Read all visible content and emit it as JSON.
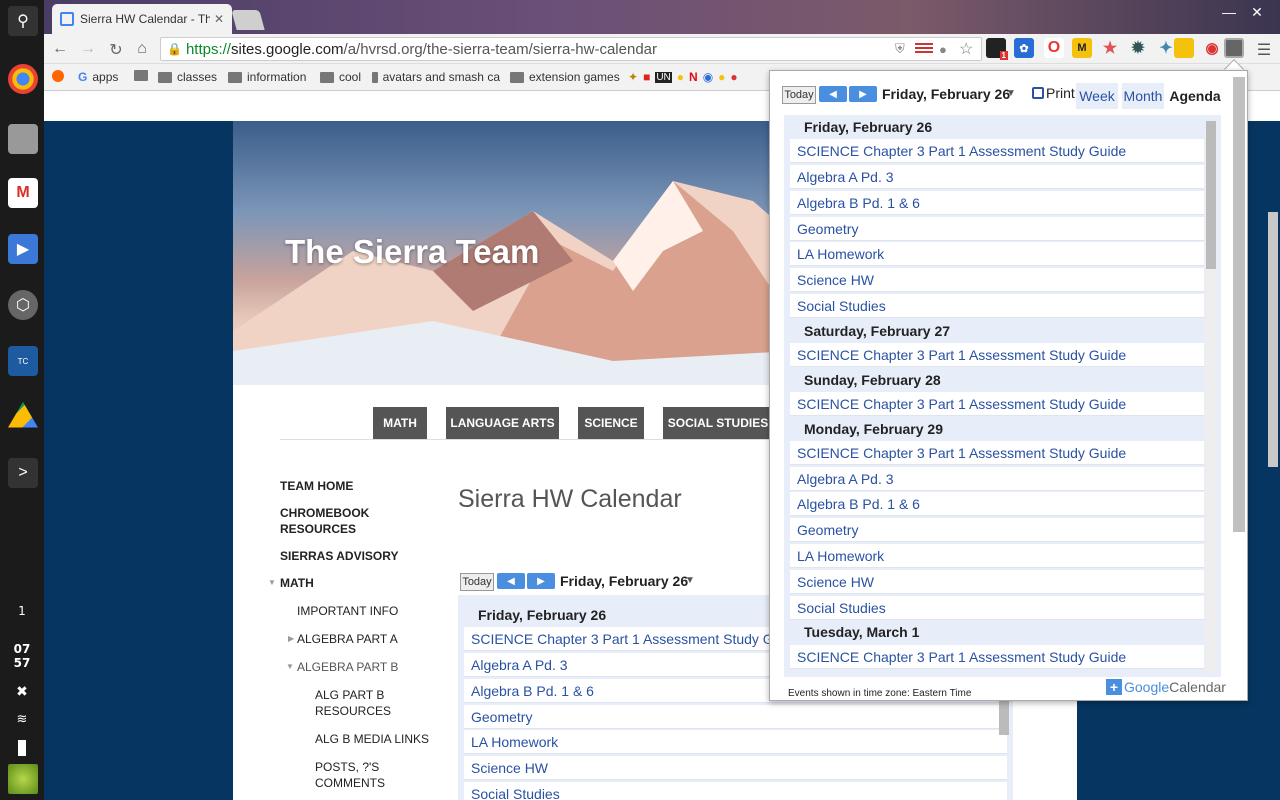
{
  "shelf": {
    "apps": [
      "chrome-icon",
      "windows-icon",
      "gmail-icon",
      "classroom-icon",
      "geogebra-icon",
      "typingclub-icon",
      "drive-icon"
    ],
    "expand_label": ">",
    "workspace_num": "1",
    "clock_hour": "07",
    "clock_min": "57"
  },
  "browser": {
    "tab_title": "Sierra HW Calendar - The",
    "url_https": "https://",
    "url_host": "sites.google.com",
    "url_path": "/a/hvrsd.org/the-sierra-team/sierra-hw-calendar",
    "badge_count": "1",
    "bookmarks": [
      "apps",
      "",
      "classes",
      "information",
      "cool",
      "avatars and smash ca",
      "extension games"
    ]
  },
  "site": {
    "title": "The Sierra Team",
    "nav": [
      "MATH",
      "LANGUAGE ARTS",
      "SCIENCE",
      "SOCIAL STUDIES"
    ],
    "sidebar": [
      "TEAM HOME",
      "CHROMEBOOK RESOURCES",
      "SIERRAS ADVISORY",
      "MATH",
      "IMPORTANT INFO",
      "ALGEBRA PART A",
      "ALGEBRA PART B",
      "ALG PART B RESOURCES",
      "ALG B MEDIA LINKS",
      "POSTS, ?'S COMMENTS"
    ],
    "heading": "Sierra HW Calendar"
  },
  "calendar": {
    "today_label": "Today",
    "date_label": "Friday, February 26",
    "print_label": "Print",
    "views": [
      "Week",
      "Month",
      "Agenda"
    ],
    "selected_view": "Agenda",
    "days": [
      {
        "label": "Friday, February 26",
        "events": [
          "SCIENCE Chapter 3 Part 1 Assessment Study Guide",
          "Algebra A Pd. 3",
          "Algebra B Pd. 1 & 6",
          "Geometry",
          "LA Homework",
          "Science HW",
          "Social Studies"
        ]
      },
      {
        "label": "Saturday, February 27",
        "events": [
          "SCIENCE Chapter 3 Part 1 Assessment Study Guide"
        ]
      },
      {
        "label": "Sunday, February 28",
        "events": [
          "SCIENCE Chapter 3 Part 1 Assessment Study Guide"
        ]
      },
      {
        "label": "Monday, February 29",
        "events": [
          "SCIENCE Chapter 3 Part 1 Assessment Study Guide",
          "Algebra A Pd. 3",
          "Algebra B Pd. 1 & 6",
          "Geometry",
          "LA Homework",
          "Science HW",
          "Social Studies"
        ]
      },
      {
        "label": "Tuesday, March 1",
        "events": [
          "SCIENCE Chapter 3 Part 1 Assessment Study Guide"
        ]
      }
    ],
    "timezone": "Events shown in time zone: Eastern Time",
    "brand_google": "Google",
    "brand_calendar": "Calendar"
  },
  "colors": {
    "link": "#2952a3",
    "page_bg": "#063562",
    "nav_tab": "#555555"
  }
}
